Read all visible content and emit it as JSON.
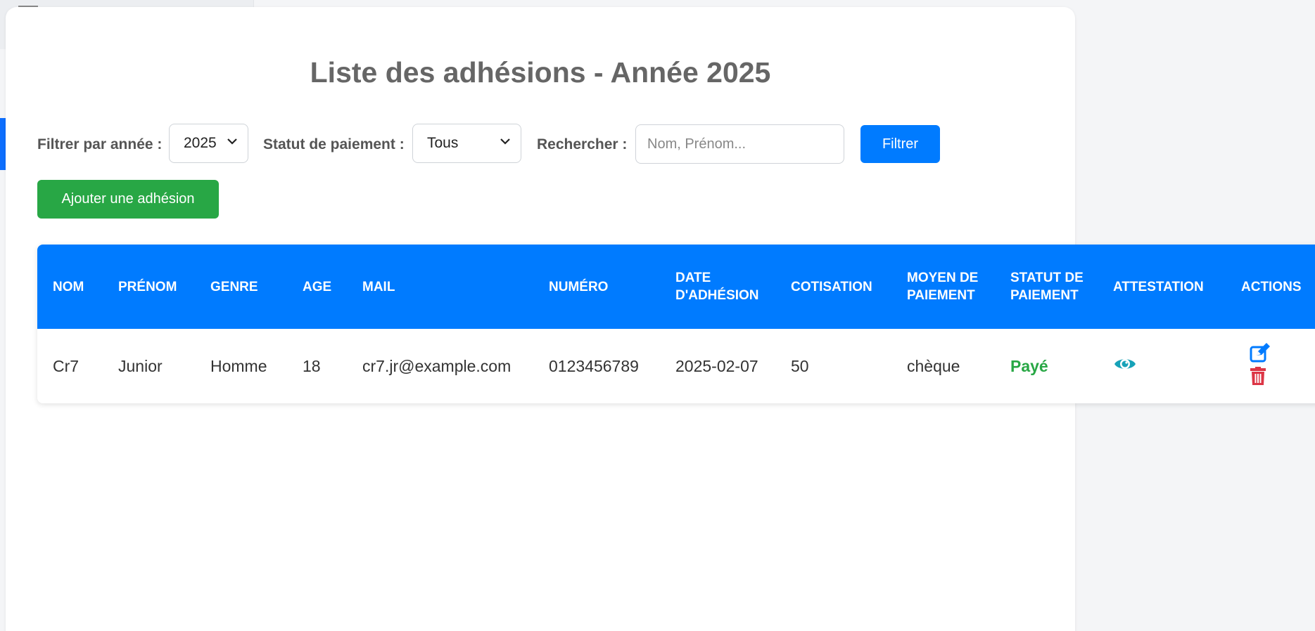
{
  "page": {
    "title": "Liste des adhésions - Année 2025"
  },
  "filters": {
    "year_label": "Filtrer par année :",
    "year_value": "2025",
    "status_label": "Statut de paiement :",
    "status_value": "Tous",
    "search_label": "Rechercher :",
    "search_placeholder": "Nom, Prénom...",
    "search_value": "",
    "filter_button": "Filtrer"
  },
  "actions": {
    "add_button": "Ajouter une adhésion"
  },
  "table": {
    "headers": {
      "nom": "Nom",
      "prenom": "Prénom",
      "genre": "Genre",
      "age": "Age",
      "mail": "Mail",
      "numero": "Numéro",
      "date_adhesion": "Date d'adhésion",
      "cotisation": "Cotisation",
      "moyen_paiement": "Moyen de paiement",
      "statut_paiement": "Statut de paiement",
      "attestation": "Attestation",
      "actions": "Actions"
    },
    "rows": [
      {
        "nom": "Cr7",
        "prenom": "Junior",
        "genre": "Homme",
        "age": "18",
        "mail": "cr7.jr@example.com",
        "numero": "0123456789",
        "date_adhesion": "2025-02-07",
        "cotisation": "50",
        "moyen_paiement": "chèque",
        "statut_paiement": "Payé"
      }
    ]
  },
  "icons": {
    "attestation": "eye-icon",
    "edit": "edit-icon",
    "delete": "trash-icon"
  },
  "colors": {
    "primary": "#007bff",
    "success": "#28a745",
    "danger": "#dc3545",
    "info": "#17a2b8",
    "title": "#666666"
  }
}
